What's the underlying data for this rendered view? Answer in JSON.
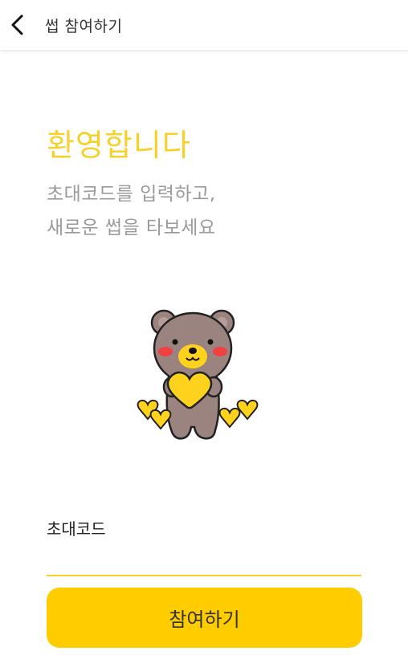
{
  "header": {
    "title": "썹 참여하기",
    "back_icon": "chevron-left-icon"
  },
  "main": {
    "welcome": "환영합니다",
    "subtitle_line1": "초대코드를 입력하고,",
    "subtitle_line2": "새로운 썹을 타보세요",
    "illustration": "bear-holding-hearts"
  },
  "form": {
    "code_label": "초대코드",
    "code_value": "",
    "code_placeholder": "",
    "submit_label": "참여하기"
  },
  "colors": {
    "accent": "#f7d02a",
    "button": "#ffcc00",
    "subtext": "#9a9a9a"
  }
}
